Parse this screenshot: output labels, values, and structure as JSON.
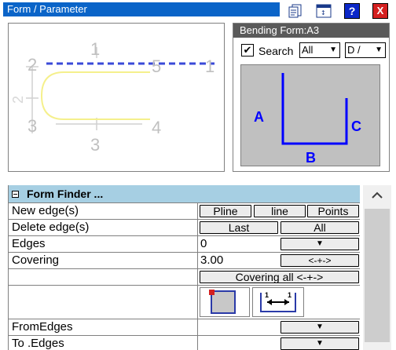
{
  "window": {
    "title": "Form / Parameter"
  },
  "toolbar": {
    "doc_icon": "document-icon",
    "window_icon": "window-icon",
    "help_label": "?",
    "close_label": "X"
  },
  "preview": {
    "point_labels": [
      "1",
      "2",
      "3",
      "4",
      "5",
      "1",
      "2",
      "3"
    ],
    "dim_label_side": "2",
    "dim_label_bottom": "3"
  },
  "bending_form": {
    "title": "Bending Form:A3",
    "search_checked": "✔",
    "search_label": "Search",
    "filter_value": "All",
    "type_value": "D /",
    "edge_labels": {
      "a": "A",
      "b": "B",
      "c": "C"
    }
  },
  "form_finder": {
    "title": "Form Finder ...",
    "rows": {
      "new_edges": {
        "label": "New edge(s)",
        "buttons": [
          "Pline",
          "line",
          "Points"
        ]
      },
      "delete_edges": {
        "label": "Delete edge(s)",
        "buttons": [
          "Last",
          "All"
        ]
      },
      "edges": {
        "label": "Edges",
        "value": "0"
      },
      "covering": {
        "label": "Covering",
        "value": "3.00",
        "button": "<-+->"
      },
      "covering_all": {
        "button": "Covering all <-+->"
      },
      "from_edges": {
        "label": "FromEdges"
      },
      "to_edges": {
        "label": "To .Edges"
      }
    }
  },
  "colors": {
    "title_bar": "#0a64c8",
    "header": "#a6cfe3",
    "form_line": "#0000ff",
    "preview_curve": "#f5f08c"
  }
}
